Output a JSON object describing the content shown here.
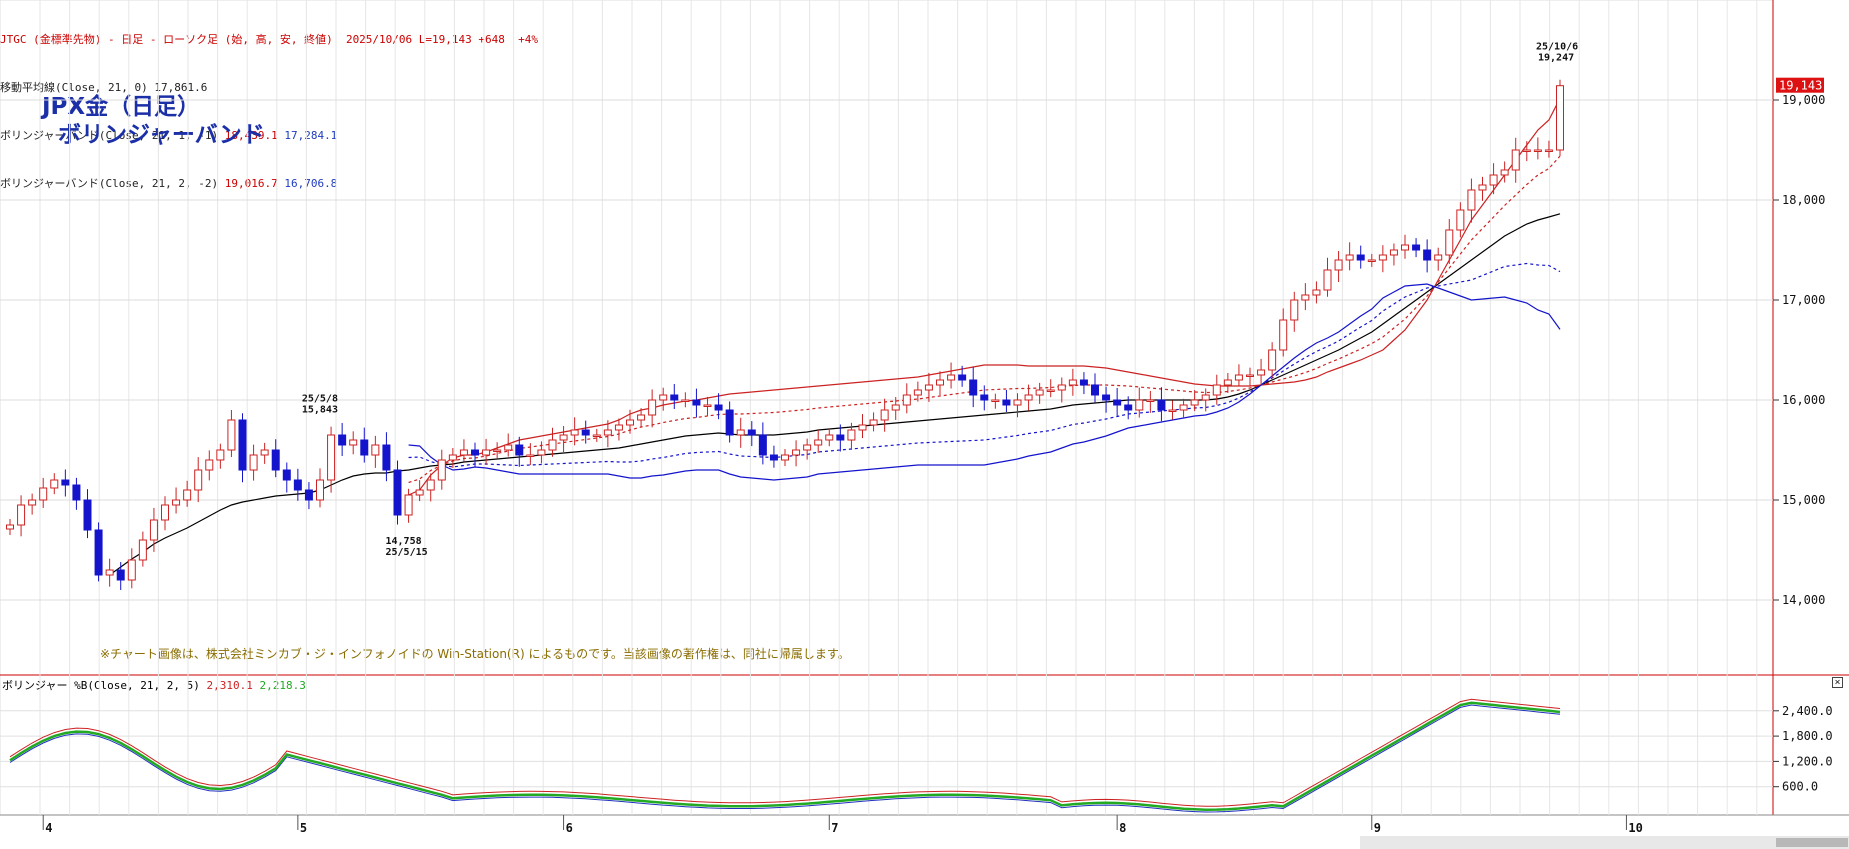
{
  "header": {
    "line1": "JTGC (金標準先物) - 日足 - ローソク足 (始, 高, 安, 終値)  2025/10/06 L=19,143 +648  +4%",
    "line2_label": "移動平均線(Close, 21, 0) ",
    "line2_value": "17,861.6",
    "line3_label": "ボリンジャーバンド(Close, 21, 1, -1) ",
    "line3_upper": "18,439.1",
    "line3_lower": "17,284.1",
    "line4_label": "ボリンジャーバンド(Close, 21, 2, -2) ",
    "line4_upper": "19,016.7",
    "line4_lower": "16,706.8"
  },
  "title": {
    "line1": "JPX金（日足）",
    "line2": "ボリンジャーバンド"
  },
  "notice": "※チャート画像は、株式会社ミンカブ・ジ・インフォノイドの Win-Station(R) によるものです。当該画像の著作権は、同社に帰属します。",
  "lower": {
    "label": "ボリンジャー %B(Close, 21, 2, 5) ",
    "v1": "2,310.1",
    "v2": "2,218.3"
  },
  "annotations": {
    "high_may": "25/5/8",
    "high_may_val": "15,843",
    "low_may_val": "14,758",
    "low_may": "25/5/15",
    "high_oct": "25/10/6",
    "high_oct_val": "19,247",
    "last_price": "19,143"
  },
  "colors": {
    "up": "#cc2222",
    "down": "#1414cc",
    "ma": "#000000",
    "band1": "#cc2222",
    "band2": "#1414cc",
    "pb_red": "#cc2222",
    "pb_blue": "#2030c0",
    "pb_green": "#22aa22",
    "frame": "#cc0000"
  },
  "chart_data": {
    "type": "candlestick",
    "price_axis": {
      "min": 13000,
      "max": 19700,
      "ticks": [
        14000,
        15000,
        16000,
        17000,
        18000,
        19000
      ],
      "tick_labels": [
        "14,000",
        "15,000",
        "16,000",
        "17,000",
        "18,000",
        "19,000"
      ]
    },
    "x_labels": [
      {
        "label": "4",
        "i": 3
      },
      {
        "label": "5",
        "i": 26
      },
      {
        "label": "6",
        "i": 50
      },
      {
        "label": "7",
        "i": 74
      },
      {
        "label": "8",
        "i": 100
      },
      {
        "label": "9",
        "i": 123
      },
      {
        "label": "10",
        "i": 146
      }
    ],
    "closes": [
      14750,
      14950,
      15000,
      15120,
      15200,
      15150,
      15000,
      14700,
      14250,
      14300,
      14200,
      14400,
      14600,
      14800,
      14950,
      15000,
      15100,
      15300,
      15400,
      15500,
      15800,
      15300,
      15450,
      15500,
      15300,
      15200,
      15100,
      15000,
      15200,
      15650,
      15550,
      15600,
      15450,
      15550,
      15300,
      14850,
      15050,
      15100,
      15200,
      15400,
      15450,
      15500,
      15450,
      15500,
      15500,
      15550,
      15450,
      15450,
      15500,
      15600,
      15650,
      15700,
      15650,
      15650,
      15700,
      15750,
      15800,
      15850,
      16000,
      16050,
      16000,
      16000,
      15950,
      15950,
      15900,
      15650,
      15700,
      15650,
      15450,
      15400,
      15450,
      15500,
      15550,
      15600,
      15650,
      15600,
      15700,
      15750,
      15800,
      15900,
      15950,
      16050,
      16100,
      16150,
      16200,
      16250,
      16200,
      16050,
      16000,
      16000,
      15950,
      16000,
      16050,
      16100,
      16100,
      16150,
      16200,
      16150,
      16050,
      16000,
      15950,
      15900,
      16000,
      16000,
      15900,
      15900,
      15950,
      16000,
      16050,
      16150,
      16200,
      16250,
      16250,
      16300,
      16500,
      16800,
      17000,
      17050,
      17100,
      17300,
      17400,
      17450,
      17400,
      17400,
      17450,
      17500,
      17550,
      17500,
      17400,
      17450,
      17700,
      17900,
      18100,
      18150,
      18250,
      18300,
      18500,
      18500,
      18500,
      18500,
      19143
    ],
    "ma21": [
      14250,
      14330,
      14410,
      14480,
      14560,
      14620,
      14670,
      14720,
      14780,
      14840,
      14900,
      14950,
      14980,
      15000,
      15020,
      15040,
      15050,
      15060,
      15070,
      15100,
      15150,
      15200,
      15240,
      15260,
      15270,
      15270,
      15290,
      15300,
      15320,
      15340,
      15350,
      15360,
      15380,
      15390,
      15400,
      15410,
      15420,
      15430,
      15440,
      15450,
      15460,
      15470,
      15480,
      15490,
      15500,
      15510,
      15520,
      15540,
      15560,
      15580,
      15600,
      15620,
      15640,
      15650,
      15660,
      15670,
      15660,
      15650,
      15650,
      15650,
      15650,
      15660,
      15670,
      15680,
      15700,
      15710,
      15720,
      15730,
      15740,
      15750,
      15760,
      15770,
      15780,
      15790,
      15800,
      15810,
      15820,
      15830,
      15840,
      15850,
      15860,
      15870,
      15880,
      15890,
      15900,
      15910,
      15930,
      15950,
      15960,
      15970,
      15980,
      15990,
      16000,
      16000,
      16000,
      16000,
      16000,
      16000,
      16000,
      16000,
      16010,
      16030,
      16060,
      16100,
      16150,
      16200,
      16250,
      16300,
      16350,
      16400,
      16450,
      16500,
      16560,
      16620,
      16680,
      16760,
      16840,
      16920,
      17000,
      17080,
      17160,
      17240,
      17320,
      17400,
      17480,
      17560,
      17640,
      17700,
      17760,
      17800,
      17830,
      17861.6
    ],
    "ma_start": 0,
    "bb_upper2": [
      15050,
      15100,
      15250,
      15350,
      15420,
      15450,
      15450,
      15480,
      15520,
      15560,
      15600,
      15620,
      15640,
      15660,
      15680,
      15700,
      15720,
      15740,
      15760,
      15800,
      15860,
      15900,
      15920,
      15950,
      15970,
      15990,
      16000,
      16020,
      16040,
      16060,
      16070,
      16080,
      16090,
      16100,
      16110,
      16120,
      16130,
      16140,
      16150,
      16160,
      16170,
      16180,
      16190,
      16200,
      16210,
      16220,
      16230,
      16250,
      16270,
      16290,
      16310,
      16330,
      16350,
      16350,
      16350,
      16350,
      16340,
      16340,
      16340,
      16340,
      16340,
      16340,
      16330,
      16320,
      16300,
      16280,
      16260,
      16240,
      16220,
      16200,
      16180,
      16160,
      16150,
      16140,
      16140,
      16140,
      16140,
      16150,
      16160,
      16170,
      16180,
      16200,
      16230,
      16280,
      16320,
      16360,
      16400,
      16450,
      16500,
      16600,
      16700,
      16850,
      17000,
      17200,
      17400,
      17600,
      17800,
      17950,
      18100,
      18250,
      18400,
      18550,
      18700,
      18800,
      19016.7
    ]
  }
}
